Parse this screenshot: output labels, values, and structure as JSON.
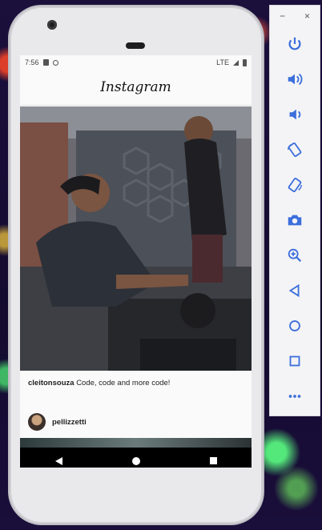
{
  "status_bar": {
    "time": "7:56",
    "network": "LTE"
  },
  "app": {
    "title": "Instagram"
  },
  "post": {
    "username": "cleitonsouza",
    "caption": "Code, code and more code!"
  },
  "next_post": {
    "username": "pellizzetti"
  },
  "toolbar": {
    "minimize": "−",
    "close": "×"
  },
  "colors": {
    "toolbar_icon": "#3c6fdc",
    "phone_body": "#e9e9ec"
  }
}
